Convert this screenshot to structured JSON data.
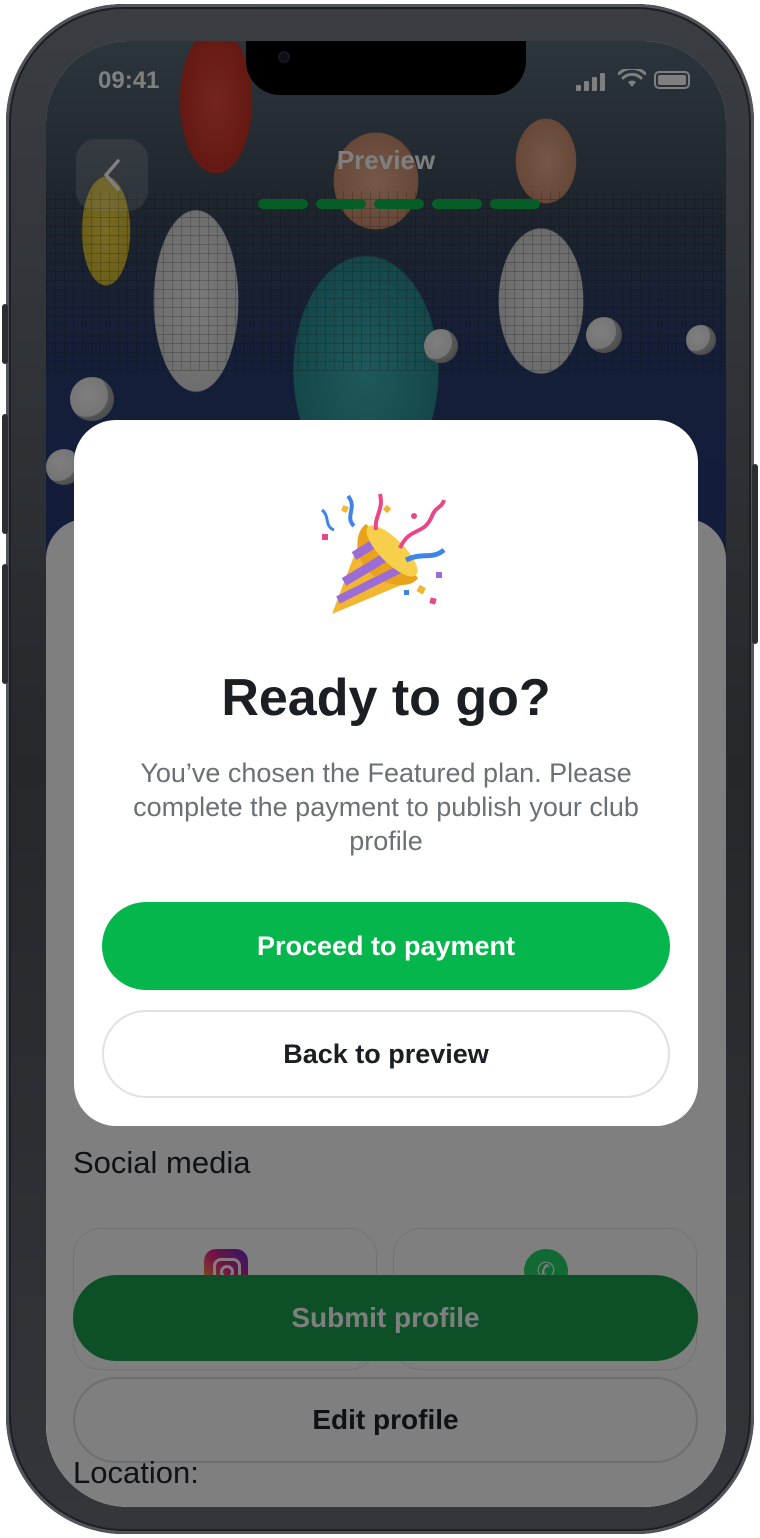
{
  "status_bar": {
    "time": "09:41"
  },
  "nav": {
    "title": "Preview",
    "progress_steps_total": 5,
    "progress_steps_completed": 5
  },
  "colors": {
    "accent": "#04B64B",
    "overlay": "rgba(0,0,0,0.5)"
  },
  "page": {
    "social_media_label": "Social media",
    "social_links": [
      {
        "icon": "instagram-icon"
      },
      {
        "icon": "phone-icon"
      }
    ],
    "submit_label": "Submit profile",
    "edit_label": "Edit profile",
    "location_label": "Location:"
  },
  "modal": {
    "icon": "party-popper-icon",
    "title": "Ready to go?",
    "body": "You’ve chosen the Featured plan. Please complete the payment to publish your club profile",
    "primary_label": "Proceed to payment",
    "secondary_label": "Back to preview"
  }
}
